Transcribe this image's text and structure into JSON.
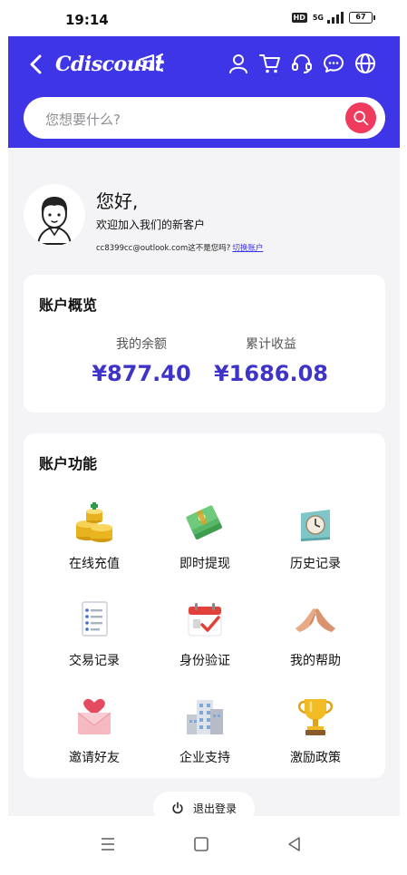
{
  "status": {
    "time": "19:14",
    "hd": "HD",
    "network": "5G",
    "battery": "67"
  },
  "header": {
    "logo": "Cdiscount",
    "icons": [
      "back-icon",
      "user-icon",
      "cart-icon",
      "headset-icon",
      "chat-icon",
      "globe-icon"
    ]
  },
  "search": {
    "placeholder": "您想要什么?",
    "icon": "search-icon"
  },
  "profile": {
    "greeting": "您好,",
    "welcome": "欢迎加入我们的新客户",
    "email_text": "cc8399cc@outlook.com这不是您吗?",
    "switch_label": "切换账户"
  },
  "overview": {
    "title": "账户概览",
    "balance_label": "我的余额",
    "balance_value": "¥877.40",
    "earnings_label": "累计收益",
    "earnings_value": "¥1686.08"
  },
  "functions": {
    "title": "账户功能",
    "items": [
      {
        "label": "在线充值",
        "icon": "coins-icon"
      },
      {
        "label": "即时提现",
        "icon": "cash-icon"
      },
      {
        "label": "历史记录",
        "icon": "clock-book-icon"
      },
      {
        "label": "交易记录",
        "icon": "document-list-icon"
      },
      {
        "label": "身份验证",
        "icon": "calendar-check-icon"
      },
      {
        "label": "我的帮助",
        "icon": "hands-icon"
      },
      {
        "label": "邀请好友",
        "icon": "heart-envelope-icon"
      },
      {
        "label": "企业支持",
        "icon": "building-icon"
      },
      {
        "label": "激励政策",
        "icon": "trophy-icon"
      }
    ]
  },
  "logout": {
    "label": "退出登录",
    "icon": "power-icon"
  },
  "navbar": {
    "icons": [
      "menu-icon",
      "home-square-icon",
      "back-triangle-icon"
    ]
  },
  "colors": {
    "brand": "#3e35e6",
    "accent": "#ef3b5d",
    "value": "#3e35c8",
    "background": "#f4f4f6"
  }
}
